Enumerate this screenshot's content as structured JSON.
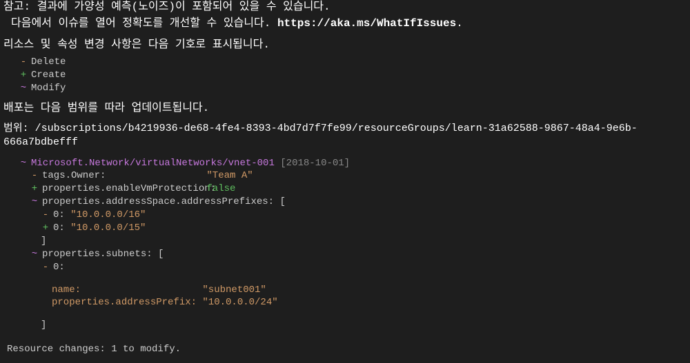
{
  "note": "참고: 결과에 가양성 예측(노이즈)이 포함되어 있을 수 있습니다.",
  "improve_prefix": "다음에서 이슈를 열어 정확도를 개선할 수 있습니다. ",
  "improve_link": "https://aka.ms/WhatIfIssues",
  "improve_suffix": ".",
  "legend_title": "리소스 및 속성 변경 사항은 다음 기호로 표시됩니다.",
  "legend": {
    "delete": {
      "sym": "-",
      "label": "Delete"
    },
    "create": {
      "sym": "+",
      "label": "Create"
    },
    "modify": {
      "sym": "~",
      "label": "Modify"
    }
  },
  "deploy_title": "배포는 다음 범위를 따라 업데이트됩니다.",
  "scope_label": "범위:",
  "scope_path": "/subscriptions/b4219936-de68-4fe4-8393-4bd7d7f7fe99/resourceGroups/learn-31a62588-9867-48a4-9e6b-666a7bdbefff",
  "resource": {
    "sym": "~",
    "id": "Microsoft.Network/virtualNetworks/vnet-001",
    "api": "[2018-10-01]"
  },
  "props": {
    "tags_owner": {
      "sym": "-",
      "key": "tags.Owner:",
      "val": "\"Team A\""
    },
    "enable_vm": {
      "sym": "+",
      "key": "properties.enableVmProtection:",
      "val": "false"
    },
    "addr_pref": {
      "sym": "~",
      "key": "properties.addressSpace.addressPrefixes: ["
    },
    "ap_del": {
      "sym": "-",
      "key": "0:",
      "val": "\"10.0.0.0/16\""
    },
    "ap_add": {
      "sym": "+",
      "key": "0:",
      "val": "\"10.0.0.0/15\""
    },
    "close1": "]",
    "subnets": {
      "sym": "~",
      "key": "properties.subnets: ["
    },
    "sub_del": {
      "sym": "-",
      "key": "0:"
    },
    "sub_name": {
      "key": "name:",
      "val": "\"subnet001\""
    },
    "sub_ap": {
      "key": "properties.addressPrefix:",
      "val": "\"10.0.0.0/24\""
    },
    "close2": "]"
  },
  "summary": "Resource changes: 1 to modify."
}
